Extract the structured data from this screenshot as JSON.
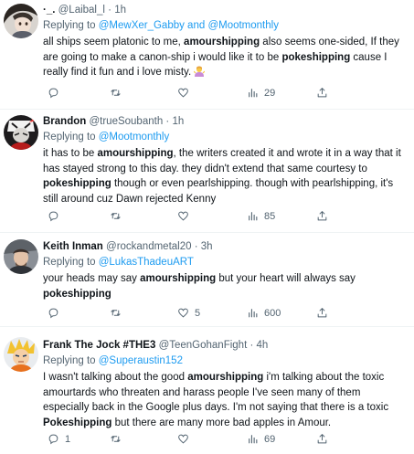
{
  "tweets": [
    {
      "name": "·_. ",
      "handle": "@Laibal_l",
      "sep": "·",
      "time": "1h",
      "reply_prefix": "Replying to ",
      "reply_to": "@MewXer_Gabby and @Mootmonthly",
      "segments": [
        {
          "t": "all ships seem platonic to me, ",
          "b": false
        },
        {
          "t": "amourshipping",
          "b": true
        },
        {
          "t": " also seems one-sided, If they are going to make a canon-ship i would like it to be ",
          "b": false
        },
        {
          "t": "pokeshipping",
          "b": true
        },
        {
          "t": " cause I really find it fun and i love misty. ",
          "b": false
        }
      ],
      "replies": "",
      "retweets": "",
      "likes": "",
      "views": "29"
    },
    {
      "name": "Brandon",
      "handle": "@trueSoubanth",
      "sep": "·",
      "time": "1h",
      "reply_prefix": "Replying to ",
      "reply_to": "@Mootmonthly",
      "segments": [
        {
          "t": "it has to be ",
          "b": false
        },
        {
          "t": "amourshipping",
          "b": true
        },
        {
          "t": ", the writers created it and wrote it in a way that it has stayed strong to this day. they didn't extend that same courtesy to ",
          "b": false
        },
        {
          "t": "pokeshipping",
          "b": true
        },
        {
          "t": " though or even pearlshipping. though with pearlshipping, it's still around cuz Dawn rejected Kenny",
          "b": false
        }
      ],
      "replies": "",
      "retweets": "",
      "likes": "",
      "views": "85"
    },
    {
      "name": "Keith Inman",
      "handle": "@rockandmetal20",
      "sep": "·",
      "time": "3h",
      "reply_prefix": "Replying to ",
      "reply_to": "@LukasThadeuART",
      "segments": [
        {
          "t": "your heads may say ",
          "b": false
        },
        {
          "t": "amourshipping",
          "b": true
        },
        {
          "t": " but your heart will always say ",
          "b": false
        },
        {
          "t": "pokeshipping",
          "b": true
        }
      ],
      "replies": "",
      "retweets": "",
      "likes": "5",
      "views": "600"
    },
    {
      "name": "Frank The Jock #THE3",
      "handle": "@TeenGohanFight",
      "sep": "·",
      "time": "4h",
      "reply_prefix": "Replying to ",
      "reply_to": "@Superaustin152",
      "segments": [
        {
          "t": "I wasn't talking about the good ",
          "b": false
        },
        {
          "t": "amourshipping",
          "b": true
        },
        {
          "t": " i'm talking about the toxic amourtards who threaten and harass people I've seen many of them especially back in the Google plus days. I'm not saying that there is a toxic ",
          "b": false
        },
        {
          "t": "Pokeshipping",
          "b": true
        },
        {
          "t": " but there are many more bad apples in Amour.",
          "b": false
        }
      ],
      "replies": "1",
      "retweets": "",
      "likes": "",
      "views": "69"
    }
  ],
  "icons": {
    "reply": "reply-icon",
    "retweet": "retweet-icon",
    "like": "heart-icon",
    "views": "views-icon",
    "share": "share-icon"
  },
  "colors": {
    "link": "#1d9bf0",
    "muted": "#536471",
    "text": "#0f1419"
  }
}
